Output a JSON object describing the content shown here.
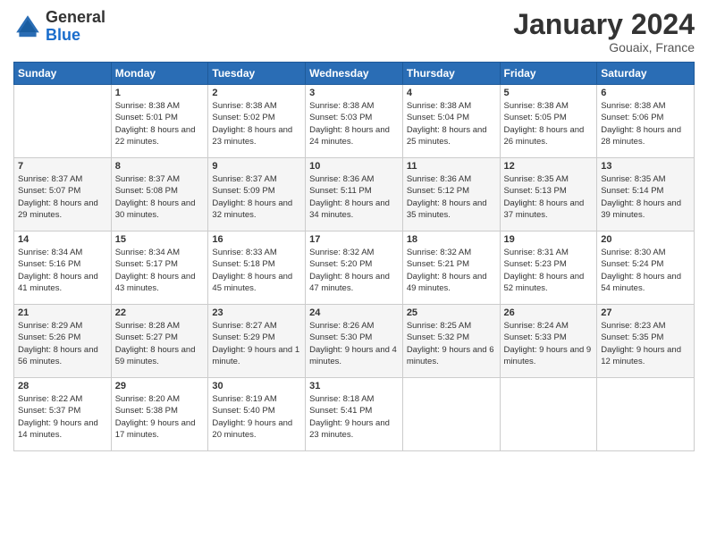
{
  "logo": {
    "general": "General",
    "blue": "Blue"
  },
  "title": "January 2024",
  "location": "Gouaix, France",
  "days_header": [
    "Sunday",
    "Monday",
    "Tuesday",
    "Wednesday",
    "Thursday",
    "Friday",
    "Saturday"
  ],
  "weeks": [
    [
      {
        "day": "",
        "sunrise": "",
        "sunset": "",
        "daylight": ""
      },
      {
        "day": "1",
        "sunrise": "Sunrise: 8:38 AM",
        "sunset": "Sunset: 5:01 PM",
        "daylight": "Daylight: 8 hours and 22 minutes."
      },
      {
        "day": "2",
        "sunrise": "Sunrise: 8:38 AM",
        "sunset": "Sunset: 5:02 PM",
        "daylight": "Daylight: 8 hours and 23 minutes."
      },
      {
        "day": "3",
        "sunrise": "Sunrise: 8:38 AM",
        "sunset": "Sunset: 5:03 PM",
        "daylight": "Daylight: 8 hours and 24 minutes."
      },
      {
        "day": "4",
        "sunrise": "Sunrise: 8:38 AM",
        "sunset": "Sunset: 5:04 PM",
        "daylight": "Daylight: 8 hours and 25 minutes."
      },
      {
        "day": "5",
        "sunrise": "Sunrise: 8:38 AM",
        "sunset": "Sunset: 5:05 PM",
        "daylight": "Daylight: 8 hours and 26 minutes."
      },
      {
        "day": "6",
        "sunrise": "Sunrise: 8:38 AM",
        "sunset": "Sunset: 5:06 PM",
        "daylight": "Daylight: 8 hours and 28 minutes."
      }
    ],
    [
      {
        "day": "7",
        "sunrise": "Sunrise: 8:37 AM",
        "sunset": "Sunset: 5:07 PM",
        "daylight": "Daylight: 8 hours and 29 minutes."
      },
      {
        "day": "8",
        "sunrise": "Sunrise: 8:37 AM",
        "sunset": "Sunset: 5:08 PM",
        "daylight": "Daylight: 8 hours and 30 minutes."
      },
      {
        "day": "9",
        "sunrise": "Sunrise: 8:37 AM",
        "sunset": "Sunset: 5:09 PM",
        "daylight": "Daylight: 8 hours and 32 minutes."
      },
      {
        "day": "10",
        "sunrise": "Sunrise: 8:36 AM",
        "sunset": "Sunset: 5:11 PM",
        "daylight": "Daylight: 8 hours and 34 minutes."
      },
      {
        "day": "11",
        "sunrise": "Sunrise: 8:36 AM",
        "sunset": "Sunset: 5:12 PM",
        "daylight": "Daylight: 8 hours and 35 minutes."
      },
      {
        "day": "12",
        "sunrise": "Sunrise: 8:35 AM",
        "sunset": "Sunset: 5:13 PM",
        "daylight": "Daylight: 8 hours and 37 minutes."
      },
      {
        "day": "13",
        "sunrise": "Sunrise: 8:35 AM",
        "sunset": "Sunset: 5:14 PM",
        "daylight": "Daylight: 8 hours and 39 minutes."
      }
    ],
    [
      {
        "day": "14",
        "sunrise": "Sunrise: 8:34 AM",
        "sunset": "Sunset: 5:16 PM",
        "daylight": "Daylight: 8 hours and 41 minutes."
      },
      {
        "day": "15",
        "sunrise": "Sunrise: 8:34 AM",
        "sunset": "Sunset: 5:17 PM",
        "daylight": "Daylight: 8 hours and 43 minutes."
      },
      {
        "day": "16",
        "sunrise": "Sunrise: 8:33 AM",
        "sunset": "Sunset: 5:18 PM",
        "daylight": "Daylight: 8 hours and 45 minutes."
      },
      {
        "day": "17",
        "sunrise": "Sunrise: 8:32 AM",
        "sunset": "Sunset: 5:20 PM",
        "daylight": "Daylight: 8 hours and 47 minutes."
      },
      {
        "day": "18",
        "sunrise": "Sunrise: 8:32 AM",
        "sunset": "Sunset: 5:21 PM",
        "daylight": "Daylight: 8 hours and 49 minutes."
      },
      {
        "day": "19",
        "sunrise": "Sunrise: 8:31 AM",
        "sunset": "Sunset: 5:23 PM",
        "daylight": "Daylight: 8 hours and 52 minutes."
      },
      {
        "day": "20",
        "sunrise": "Sunrise: 8:30 AM",
        "sunset": "Sunset: 5:24 PM",
        "daylight": "Daylight: 8 hours and 54 minutes."
      }
    ],
    [
      {
        "day": "21",
        "sunrise": "Sunrise: 8:29 AM",
        "sunset": "Sunset: 5:26 PM",
        "daylight": "Daylight: 8 hours and 56 minutes."
      },
      {
        "day": "22",
        "sunrise": "Sunrise: 8:28 AM",
        "sunset": "Sunset: 5:27 PM",
        "daylight": "Daylight: 8 hours and 59 minutes."
      },
      {
        "day": "23",
        "sunrise": "Sunrise: 8:27 AM",
        "sunset": "Sunset: 5:29 PM",
        "daylight": "Daylight: 9 hours and 1 minute."
      },
      {
        "day": "24",
        "sunrise": "Sunrise: 8:26 AM",
        "sunset": "Sunset: 5:30 PM",
        "daylight": "Daylight: 9 hours and 4 minutes."
      },
      {
        "day": "25",
        "sunrise": "Sunrise: 8:25 AM",
        "sunset": "Sunset: 5:32 PM",
        "daylight": "Daylight: 9 hours and 6 minutes."
      },
      {
        "day": "26",
        "sunrise": "Sunrise: 8:24 AM",
        "sunset": "Sunset: 5:33 PM",
        "daylight": "Daylight: 9 hours and 9 minutes."
      },
      {
        "day": "27",
        "sunrise": "Sunrise: 8:23 AM",
        "sunset": "Sunset: 5:35 PM",
        "daylight": "Daylight: 9 hours and 12 minutes."
      }
    ],
    [
      {
        "day": "28",
        "sunrise": "Sunrise: 8:22 AM",
        "sunset": "Sunset: 5:37 PM",
        "daylight": "Daylight: 9 hours and 14 minutes."
      },
      {
        "day": "29",
        "sunrise": "Sunrise: 8:20 AM",
        "sunset": "Sunset: 5:38 PM",
        "daylight": "Daylight: 9 hours and 17 minutes."
      },
      {
        "day": "30",
        "sunrise": "Sunrise: 8:19 AM",
        "sunset": "Sunset: 5:40 PM",
        "daylight": "Daylight: 9 hours and 20 minutes."
      },
      {
        "day": "31",
        "sunrise": "Sunrise: 8:18 AM",
        "sunset": "Sunset: 5:41 PM",
        "daylight": "Daylight: 9 hours and 23 minutes."
      },
      {
        "day": "",
        "sunrise": "",
        "sunset": "",
        "daylight": ""
      },
      {
        "day": "",
        "sunrise": "",
        "sunset": "",
        "daylight": ""
      },
      {
        "day": "",
        "sunrise": "",
        "sunset": "",
        "daylight": ""
      }
    ]
  ]
}
